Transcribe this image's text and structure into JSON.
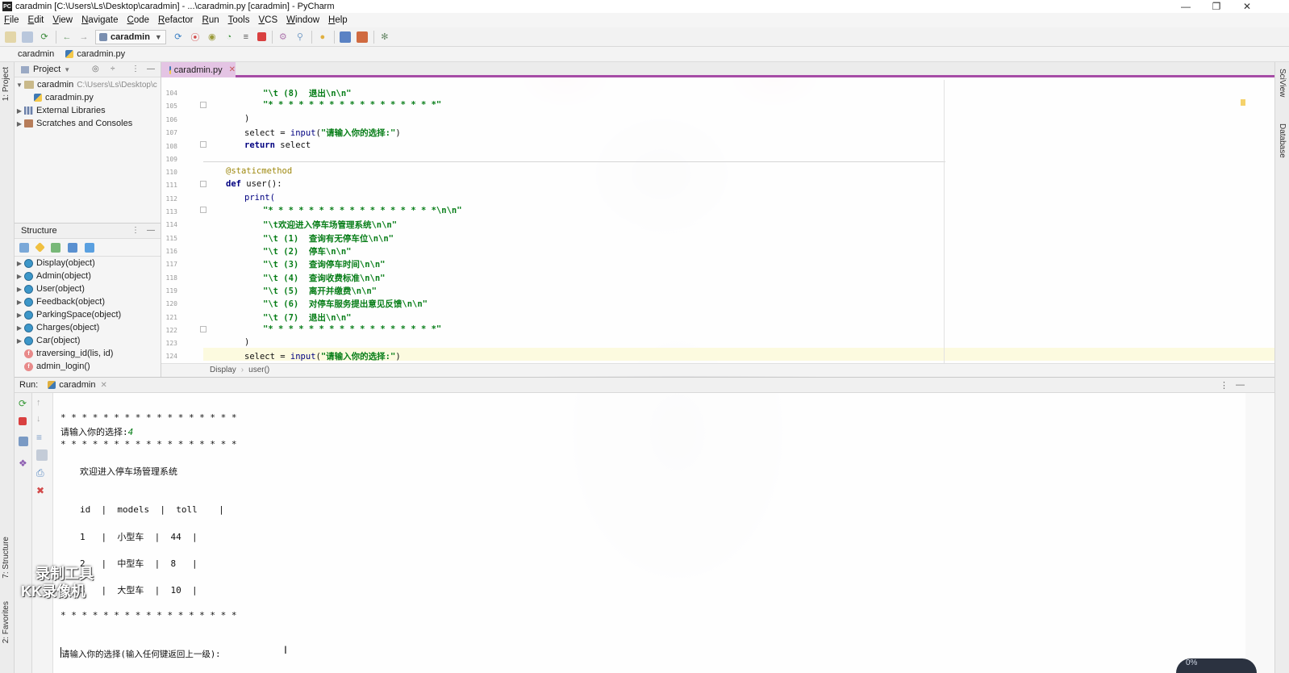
{
  "window": {
    "title": "caradmin [C:\\Users\\Ls\\Desktop\\caradmin] - ...\\caradmin.py [caradmin] - PyCharm",
    "app_icon_label": "PC"
  },
  "menu": [
    "File",
    "Edit",
    "View",
    "Navigate",
    "Code",
    "Refactor",
    "Run",
    "Tools",
    "VCS",
    "Window",
    "Help"
  ],
  "toolbar": {
    "run_config": "caradmin"
  },
  "navbar": {
    "project": "caradmin",
    "file": "caradmin.py"
  },
  "left_stripe": {
    "project_tab": "1: Project",
    "structure_tab": "7: Structure",
    "favorites_tab": "2: Favorites"
  },
  "right_stripe": {
    "sciview_tab": "SciView",
    "database_tab": "Database"
  },
  "project_panel": {
    "header": "Project",
    "root": "caradmin",
    "root_path": "C:\\Users\\Ls\\Desktop\\c",
    "file": "caradmin.py",
    "external_libraries": "External Libraries",
    "scratches": "Scratches and Consoles"
  },
  "structure_panel": {
    "header": "Structure",
    "items": [
      {
        "label": "Display(object)",
        "kind": "class"
      },
      {
        "label": "Admin(object)",
        "kind": "class"
      },
      {
        "label": "User(object)",
        "kind": "class"
      },
      {
        "label": "Feedback(object)",
        "kind": "class"
      },
      {
        "label": "ParkingSpace(object)",
        "kind": "class"
      },
      {
        "label": "Charges(object)",
        "kind": "class"
      },
      {
        "label": "Car(object)",
        "kind": "class"
      },
      {
        "label": "traversing_id(lis, id)",
        "kind": "function"
      },
      {
        "label": "admin_login()",
        "kind": "function"
      }
    ]
  },
  "editor": {
    "tab": "caradmin.py",
    "line_numbers": [
      "104",
      "105",
      "106",
      "107",
      "108",
      "109",
      "110",
      "111",
      "112",
      "113",
      "114",
      "115",
      "116",
      "117",
      "118",
      "119",
      "120",
      "121",
      "122",
      "123",
      "124"
    ],
    "lines": {
      "l104": "\"\\t (8)  退出\\n\\n\"",
      "l105": "\"* * * * * * * * * * * * * * * * *\"",
      "l106": ")",
      "l107_a": "select = ",
      "l107_b": "input",
      "l107_c": "(",
      "l107_d": "\"请输入你的选择:\"",
      "l107_e": ")",
      "l108_kw": "return",
      "l108_rest": " select",
      "l110": "@staticmethod",
      "l111_kw": "def",
      "l111_rest": " user():",
      "l112": "print(",
      "l113": "\"* * * * * * * * * * * * * * * * *\\n\\n\"",
      "l114": "\"\\t欢迎进入停车场管理系统\\n\\n\"",
      "l115": "\"\\t (1)  查询有无停车位\\n\\n\"",
      "l116": "\"\\t (2)  停车\\n\\n\"",
      "l117": "\"\\t (3)  查询停车时间\\n\\n\"",
      "l118": "\"\\t (4)  查询收费标准\\n\\n\"",
      "l119": "\"\\t (5)  离开并缴费\\n\\n\"",
      "l120": "\"\\t (6)  对停车服务提出意见反馈\\n\\n\"",
      "l121": "\"\\t (7)  退出\\n\\n\"",
      "l122": "\"* * * * * * * * * * * * * * * * *\"",
      "l123": ")",
      "l124_a": "select = ",
      "l124_b": "input",
      "l124_c": "(",
      "l124_d": "\"请输入你的选择:\"",
      "l124_e": ")"
    },
    "breadcrumb": [
      "Display",
      "user()"
    ]
  },
  "run": {
    "label": "Run:",
    "tab": "caradmin",
    "console": {
      "stars": "* * * * * * * * * * * * * * * * *",
      "prompt1": "请输入你的选择:",
      "input1": "4",
      "welcome": "欢迎进入停车场管理系统",
      "table_header": "id  |  models  |  toll    |",
      "row1": "1   |  小型车  |  44  |",
      "row2": "2   |  中型车  |  8   |",
      "row3": "3   |  大型车  |  10  |",
      "prompt2": "请输入你的选择(输入任何键返回上一级):"
    }
  },
  "overlay": {
    "watermark": [
      "录制工具",
      "KK录像机"
    ],
    "meter": "0%"
  }
}
